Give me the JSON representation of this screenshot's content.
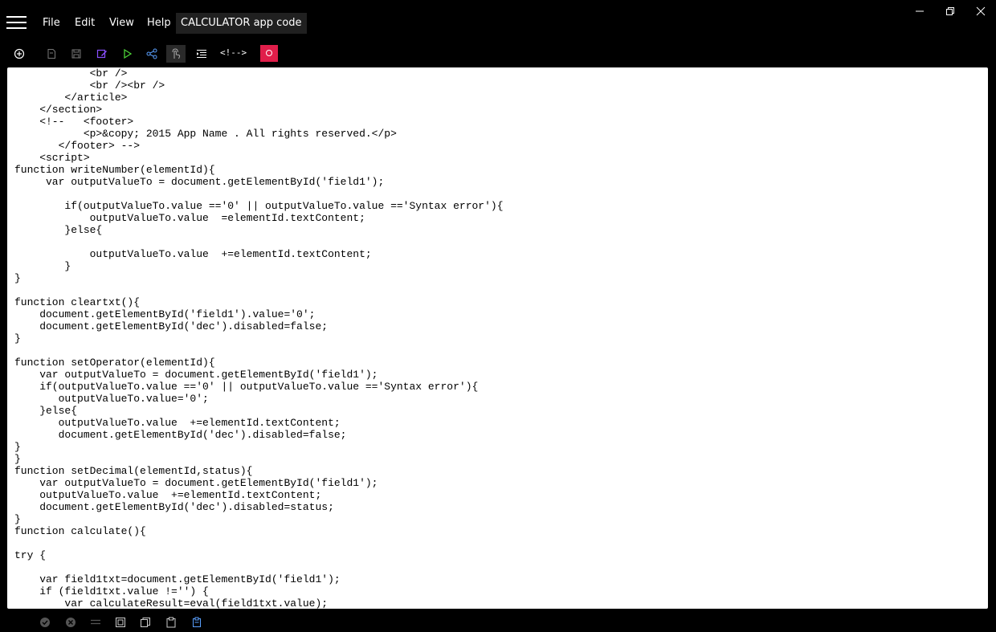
{
  "app": {
    "menu": [
      "File",
      "Edit",
      "View",
      "Help"
    ],
    "document_title": "CALCULATOR app code"
  },
  "window_controls": [
    "minimize-icon",
    "restore-icon",
    "close-icon"
  ],
  "toolbar": {
    "icons": [
      "add-circle-icon",
      "new-file-icon",
      "save-icon",
      "edit-icon",
      "run-icon",
      "share-icon",
      "touch-icon",
      "indent-icon"
    ],
    "comment_label": "<!-->",
    "record_color": "#e01e4a"
  },
  "editor": {
    "lines": [
      "            <br />",
      "            <br /><br />",
      "        </article>",
      "    </section>",
      "    <!--   <footer>",
      "           <p>&copy; 2015 App Name . All rights reserved.</p>",
      "       </footer> -->",
      "    <script>",
      "function writeNumber(elementId){",
      "     var outputValueTo = document.getElementById('field1');",
      "",
      "        if(outputValueTo.value =='0' || outputValueTo.value =='Syntax error'){",
      "            outputValueTo.value  =elementId.textContent;",
      "        }else{",
      "",
      "            outputValueTo.value  +=elementId.textContent;",
      "        }",
      "}",
      "",
      "function cleartxt(){",
      "    document.getElementById('field1').value='0';",
      "    document.getElementById('dec').disabled=false;",
      "}",
      "",
      "function setOperator(elementId){",
      "    var outputValueTo = document.getElementById('field1');",
      "    if(outputValueTo.value =='0' || outputValueTo.value =='Syntax error'){",
      "       outputValueTo.value='0';",
      "    }else{",
      "       outputValueTo.value  +=elementId.textContent;",
      "       document.getElementById('dec').disabled=false;",
      "}",
      "}",
      "function setDecimal(elementId,status){",
      "    var outputValueTo = document.getElementById('field1');",
      "    outputValueTo.value  +=elementId.textContent;",
      "    document.getElementById('dec').disabled=status;",
      "}",
      "function calculate(){",
      "",
      "try {",
      "",
      "    var field1txt=document.getElementById('field1');",
      "    if (field1txt.value !='') {",
      "        var calculateResult=eval(field1txt.value);"
    ]
  },
  "statusbar": {
    "icons": [
      "check-circle-icon",
      "cancel-circle-icon",
      "menu-lines-icon",
      "select-all-icon",
      "copy-icon",
      "paste-icon",
      "clipboard-icon"
    ]
  }
}
